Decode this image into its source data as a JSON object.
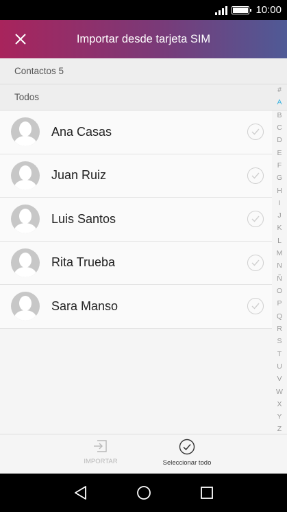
{
  "status_bar": {
    "time": "10:00",
    "signal_icon": "signal-icon",
    "battery_icon": "battery-icon"
  },
  "app_bar": {
    "title": "Importar desde tarjeta SIM",
    "close_icon": "close-icon",
    "colors": [
      "#a8245c",
      "#4f5a96"
    ]
  },
  "summary": {
    "contacts_label": "Contactos 5"
  },
  "group": {
    "label": "Todos"
  },
  "contacts": [
    {
      "name": "Ana Casas"
    },
    {
      "name": "Juan Ruiz"
    },
    {
      "name": "Luis Santos"
    },
    {
      "name": "Rita Trueba"
    },
    {
      "name": "Sara Manso"
    }
  ],
  "index": {
    "letters": [
      "#",
      "A",
      "B",
      "C",
      "D",
      "E",
      "F",
      "G",
      "H",
      "I",
      "J",
      "K",
      "L",
      "M",
      "N",
      "Ñ",
      "O",
      "P",
      "Q",
      "R",
      "S",
      "T",
      "U",
      "V",
      "W",
      "X",
      "Y",
      "Z"
    ],
    "active": "A",
    "active_color": "#3eb4e0"
  },
  "bottom_actions": {
    "import_label": "IMPORTAR",
    "import_icon": "import-icon",
    "select_all_label": "Seleccionar todo",
    "select_all_icon": "check-circle-icon"
  },
  "nav_bar": {
    "back_icon": "back-triangle-icon",
    "home_icon": "home-circle-icon",
    "recents_icon": "recents-square-icon"
  }
}
